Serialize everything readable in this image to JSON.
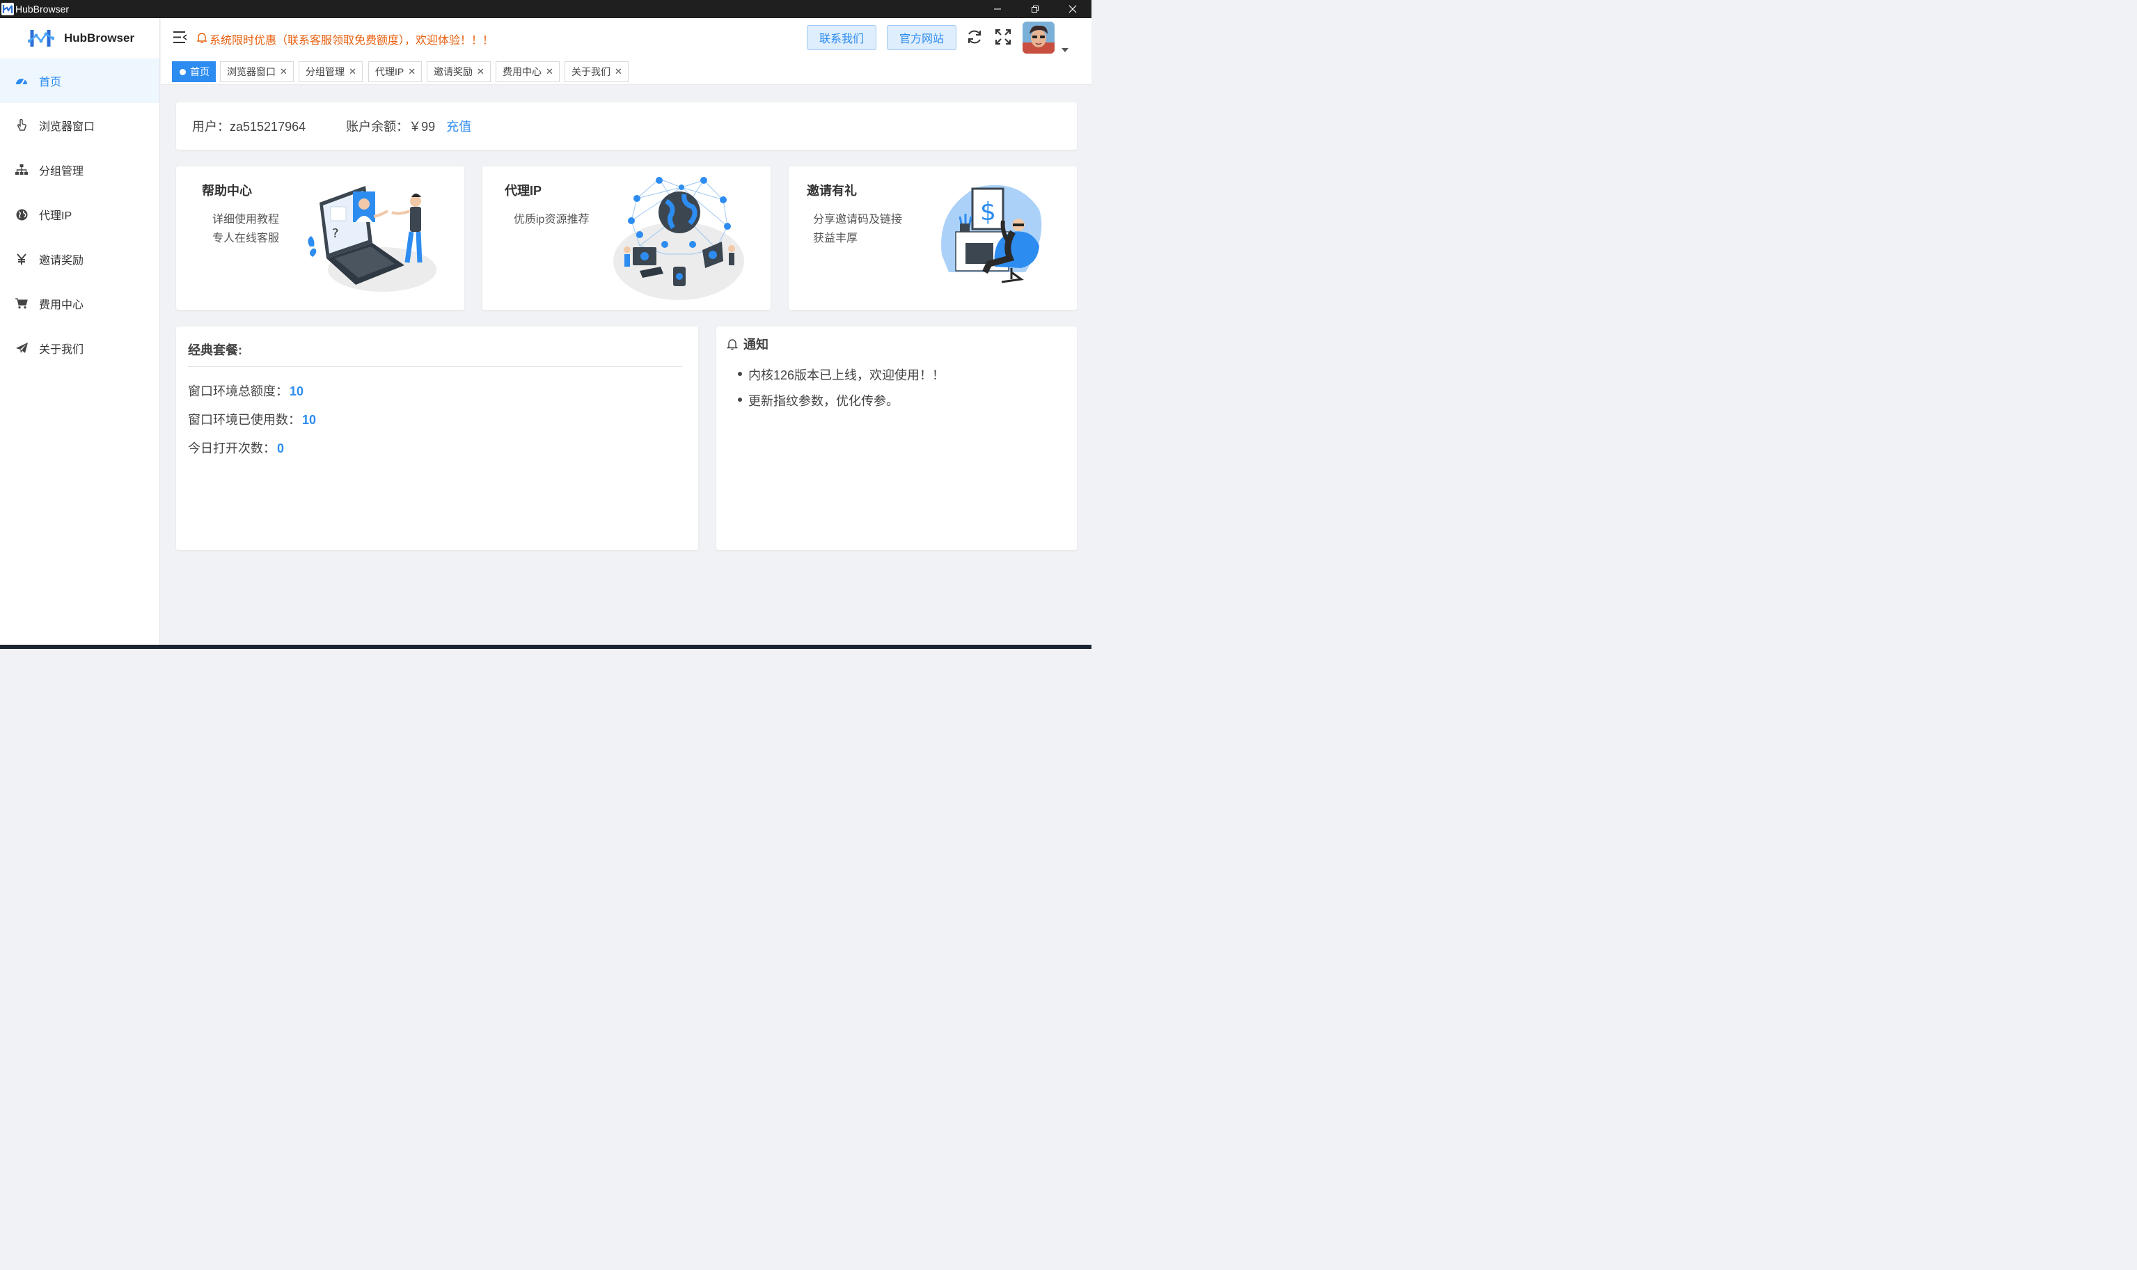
{
  "window": {
    "title": "HubBrowser",
    "minimize_icon": "minimize-icon",
    "restore_icon": "restore-icon",
    "close_icon": "close-icon"
  },
  "sidebar": {
    "brand": "HubBrowser",
    "items": [
      {
        "label": "首页",
        "icon": "dashboard-icon",
        "active": true
      },
      {
        "label": "浏览器窗口",
        "icon": "pointer-hand-icon",
        "active": false
      },
      {
        "label": "分组管理",
        "icon": "hierarchy-icon",
        "active": false
      },
      {
        "label": "代理IP",
        "icon": "globe-icon",
        "active": false
      },
      {
        "label": "邀请奖励",
        "icon": "yen-icon",
        "active": false
      },
      {
        "label": "费用中心",
        "icon": "cart-icon",
        "active": false
      },
      {
        "label": "关于我们",
        "icon": "paper-plane-icon",
        "active": false
      }
    ]
  },
  "header": {
    "notice": "系统限时优惠（联系客服领取免费额度），欢迎体验！！！",
    "contact_button": "联系我们",
    "website_button": "官方网站"
  },
  "tabs": [
    {
      "label": "首页",
      "active": true
    },
    {
      "label": "浏览器窗口"
    },
    {
      "label": "分组管理"
    },
    {
      "label": "代理IP"
    },
    {
      "label": "邀请奖励"
    },
    {
      "label": "费用中心"
    },
    {
      "label": "关于我们"
    }
  ],
  "user": {
    "user_label": "用户：za515217964",
    "balance_label": "账户余额：￥99",
    "recharge": "充值"
  },
  "features": [
    {
      "title": "帮助中心",
      "lines": [
        "详细使用教程",
        "专人在线客服"
      ]
    },
    {
      "title": "代理IP",
      "lines": [
        "优质ip资源推荐"
      ]
    },
    {
      "title": "邀请有礼",
      "lines": [
        "分享邀请码及链接",
        "获益丰厚"
      ]
    }
  ],
  "package": {
    "title": "经典套餐:",
    "rows": [
      {
        "label": "窗口环境总额度：",
        "value": "10"
      },
      {
        "label": "窗口环境已使用数：",
        "value": "10"
      },
      {
        "label": "今日打开次数：",
        "value": "0"
      }
    ]
  },
  "notices": {
    "title": "通知",
    "items": [
      "内核126版本已上线，欢迎使用！！",
      "更新指纹参数，优化传参。"
    ]
  },
  "colors": {
    "accent": "#2d8cf0",
    "notice_orange": "#e85e0c",
    "titlebar": "#1f1f1f"
  }
}
